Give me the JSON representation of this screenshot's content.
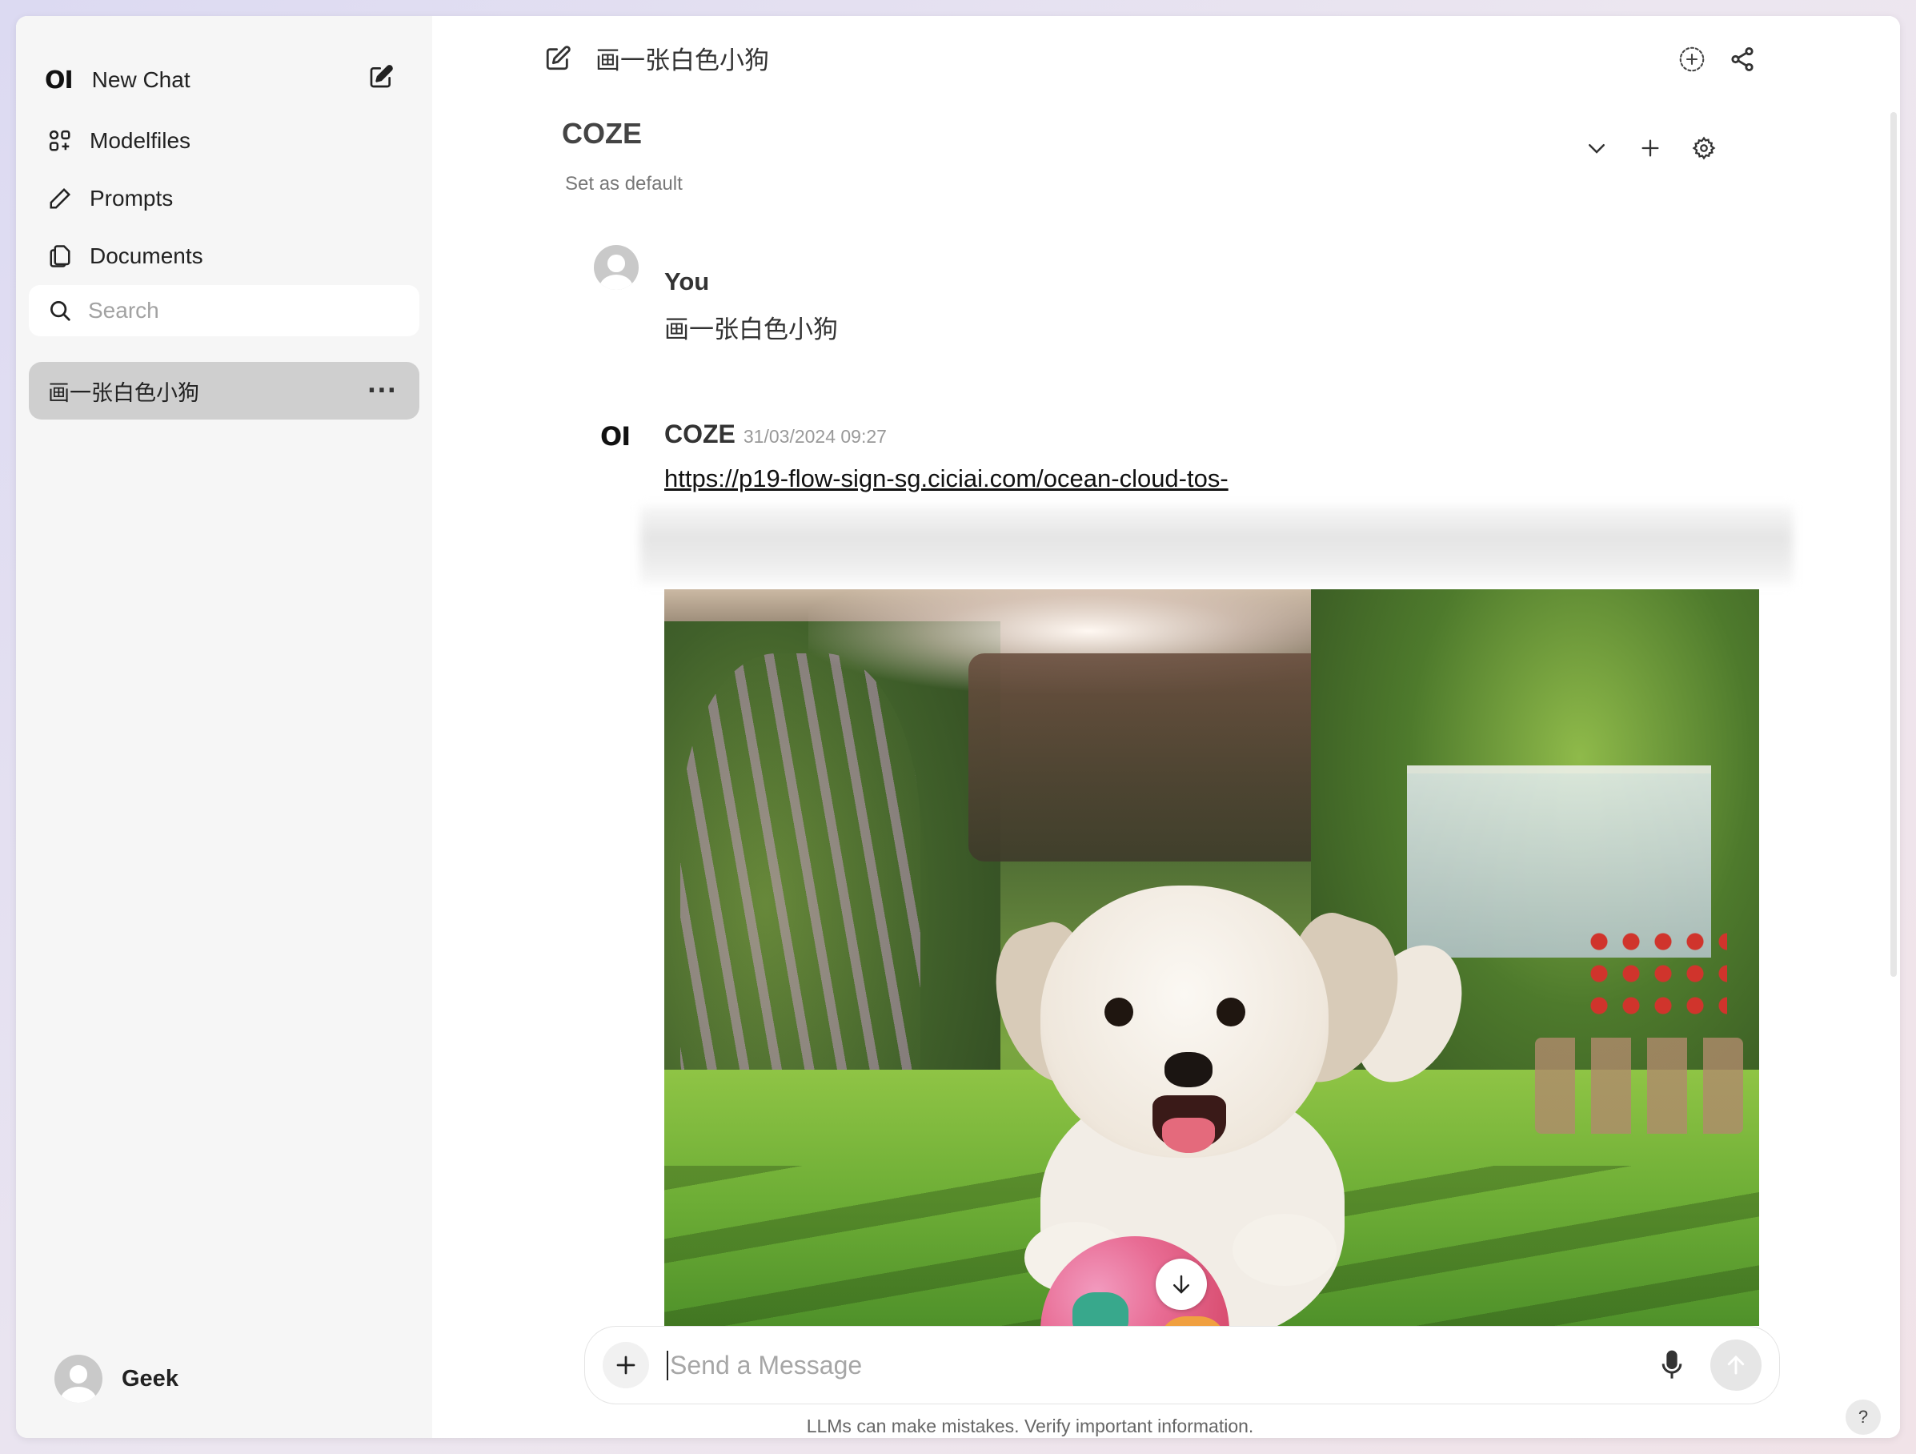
{
  "sidebar": {
    "logo": "OI",
    "new_chat": "New Chat",
    "nav": [
      {
        "label": "Modelfiles",
        "icon": "modelfiles-icon"
      },
      {
        "label": "Prompts",
        "icon": "pencil-icon"
      },
      {
        "label": "Documents",
        "icon": "documents-icon"
      }
    ],
    "search_placeholder": "Search",
    "chats": [
      {
        "title": "画一张白色小狗",
        "active": true
      }
    ],
    "user": {
      "name": "Geek"
    }
  },
  "header": {
    "chat_title": "画一张白色小狗"
  },
  "model": {
    "name": "COZE",
    "set_default": "Set as default"
  },
  "messages": [
    {
      "role": "user",
      "name": "You",
      "text": "画一张白色小狗"
    },
    {
      "role": "assistant",
      "logo": "OI",
      "name": "COZE",
      "timestamp": "31/03/2024 09:27",
      "link": "https://p19-flow-sign-sg.ciciai.com/ocean-cloud-tos-",
      "image": "white-puppy-in-garden"
    }
  ],
  "composer": {
    "placeholder": "Send a Message"
  },
  "footer": {
    "disclaimer": "LLMs can make mistakes. Verify important information.",
    "help": "?"
  },
  "colors": {
    "sidebar_bg": "#f6f6f6",
    "active_chat_bg": "#cfcfcf",
    "text": "#222222"
  }
}
